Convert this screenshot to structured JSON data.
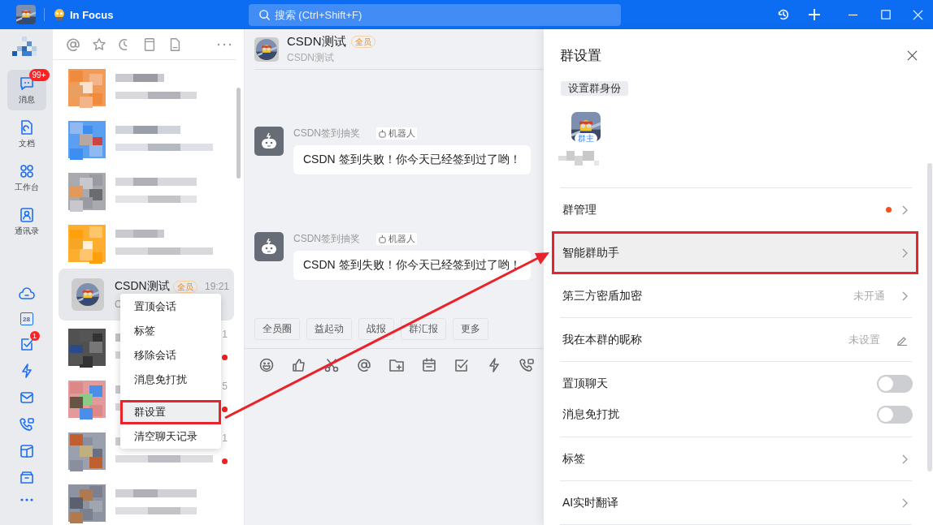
{
  "title_bar": {
    "status": "In Focus",
    "search": {
      "placeholder": "搜索 (Ctrl+Shift+F)"
    }
  },
  "nav": {
    "items": [
      {
        "kind": "chat",
        "label": "消息",
        "selected": true,
        "badge": "99+"
      },
      {
        "kind": "doc",
        "label": "文档",
        "selected": false
      },
      {
        "kind": "grid",
        "label": "工作台",
        "selected": false
      },
      {
        "kind": "contacts",
        "label": "通讯录",
        "selected": false
      }
    ],
    "apps": [
      {
        "kind": "cloud"
      },
      {
        "kind": "calendar",
        "text": "28"
      },
      {
        "kind": "todo",
        "badge": "1"
      },
      {
        "kind": "bolt"
      },
      {
        "kind": "mail"
      },
      {
        "kind": "phone"
      },
      {
        "kind": "board"
      },
      {
        "kind": "folder"
      },
      {
        "kind": "more"
      }
    ]
  },
  "chat_list": {
    "rows": [
      {
        "kind": "picture",
        "selected": false,
        "unread": false
      },
      {
        "kind": "picture",
        "selected": false,
        "unread": false
      },
      {
        "kind": "picture",
        "selected": false,
        "unread": false
      },
      {
        "kind": "picture",
        "selected": false,
        "unread": false
      },
      {
        "kind": "chat",
        "name": "CSDN测试",
        "tag": "全员",
        "time": "19:21",
        "preview": "C",
        "selected": true,
        "unread": false
      },
      {
        "kind": "picture",
        "time": "1",
        "selected": false,
        "unread": true
      },
      {
        "kind": "picture",
        "time": "5",
        "selected": false,
        "unread": true
      },
      {
        "kind": "picture",
        "time": "1",
        "selected": false,
        "unread": true
      },
      {
        "kind": "picture",
        "selected": false,
        "unread": false
      }
    ]
  },
  "context_menu": {
    "items": [
      {
        "label": "置顶会话",
        "selected": false,
        "annotated": false
      },
      {
        "label": "标签",
        "selected": false,
        "annotated": false
      },
      {
        "label": "移除会话",
        "selected": false,
        "annotated": false
      },
      {
        "label": "消息免打扰",
        "selected": false,
        "annotated": false
      },
      {
        "label": "群设置",
        "selected": true,
        "annotated": true
      },
      {
        "label": "清空聊天记录",
        "selected": false,
        "annotated": false
      }
    ]
  },
  "chat": {
    "title": "CSDN测试",
    "tag": "全员",
    "subtitle": "CSDN测试",
    "messages": [
      {
        "sender": "CSDN签到抽奖",
        "badge": "机器人",
        "text": "CSDN 签到失败！你今天已经签到过了哟！"
      },
      {
        "sender": "CSDN签到抽奖",
        "badge": "机器人",
        "text": "CSDN 签到失败！你今天已经签到过了哟！"
      }
    ],
    "quick_actions": [
      "全员圈",
      "益起动",
      "战报",
      "群汇报",
      "更多"
    ],
    "tools": [
      {
        "kind": "emoji"
      },
      {
        "kind": "like"
      },
      {
        "kind": "scissors"
      },
      {
        "kind": "at"
      },
      {
        "kind": "folder"
      },
      {
        "kind": "calendar"
      },
      {
        "kind": "check"
      },
      {
        "kind": "bolt"
      },
      {
        "kind": "phone"
      }
    ]
  },
  "panel": {
    "title": "群设置",
    "identity_button": "设置群身份",
    "owner_badge": "群主",
    "sections": [
      [
        {
          "kind": "link",
          "label": "群管理",
          "dot": true,
          "selected": false,
          "annotated": false
        },
        {
          "kind": "link",
          "label": "智能群助手",
          "dot": false,
          "selected": true,
          "annotated": true
        },
        {
          "kind": "link",
          "label": "第三方密盾加密",
          "value": "未开通",
          "dot": false,
          "selected": false,
          "annotated": false
        }
      ],
      [
        {
          "kind": "edit",
          "label": "我在本群的昵称",
          "value": "未设置",
          "dot": false,
          "selected": false,
          "annotated": false
        }
      ],
      [
        {
          "kind": "toggle",
          "label": "置顶聊天",
          "on": false,
          "dot": false,
          "selected": false,
          "annotated": false
        },
        {
          "kind": "toggle",
          "label": "消息免打扰",
          "on": false,
          "dot": false,
          "selected": false,
          "annotated": false
        }
      ],
      [
        {
          "kind": "link",
          "label": "标签",
          "dot": false,
          "selected": false,
          "annotated": false
        }
      ],
      [
        {
          "kind": "link",
          "label": "AI实时翻译",
          "dot": false,
          "selected": false,
          "annotated": false
        }
      ]
    ]
  }
}
